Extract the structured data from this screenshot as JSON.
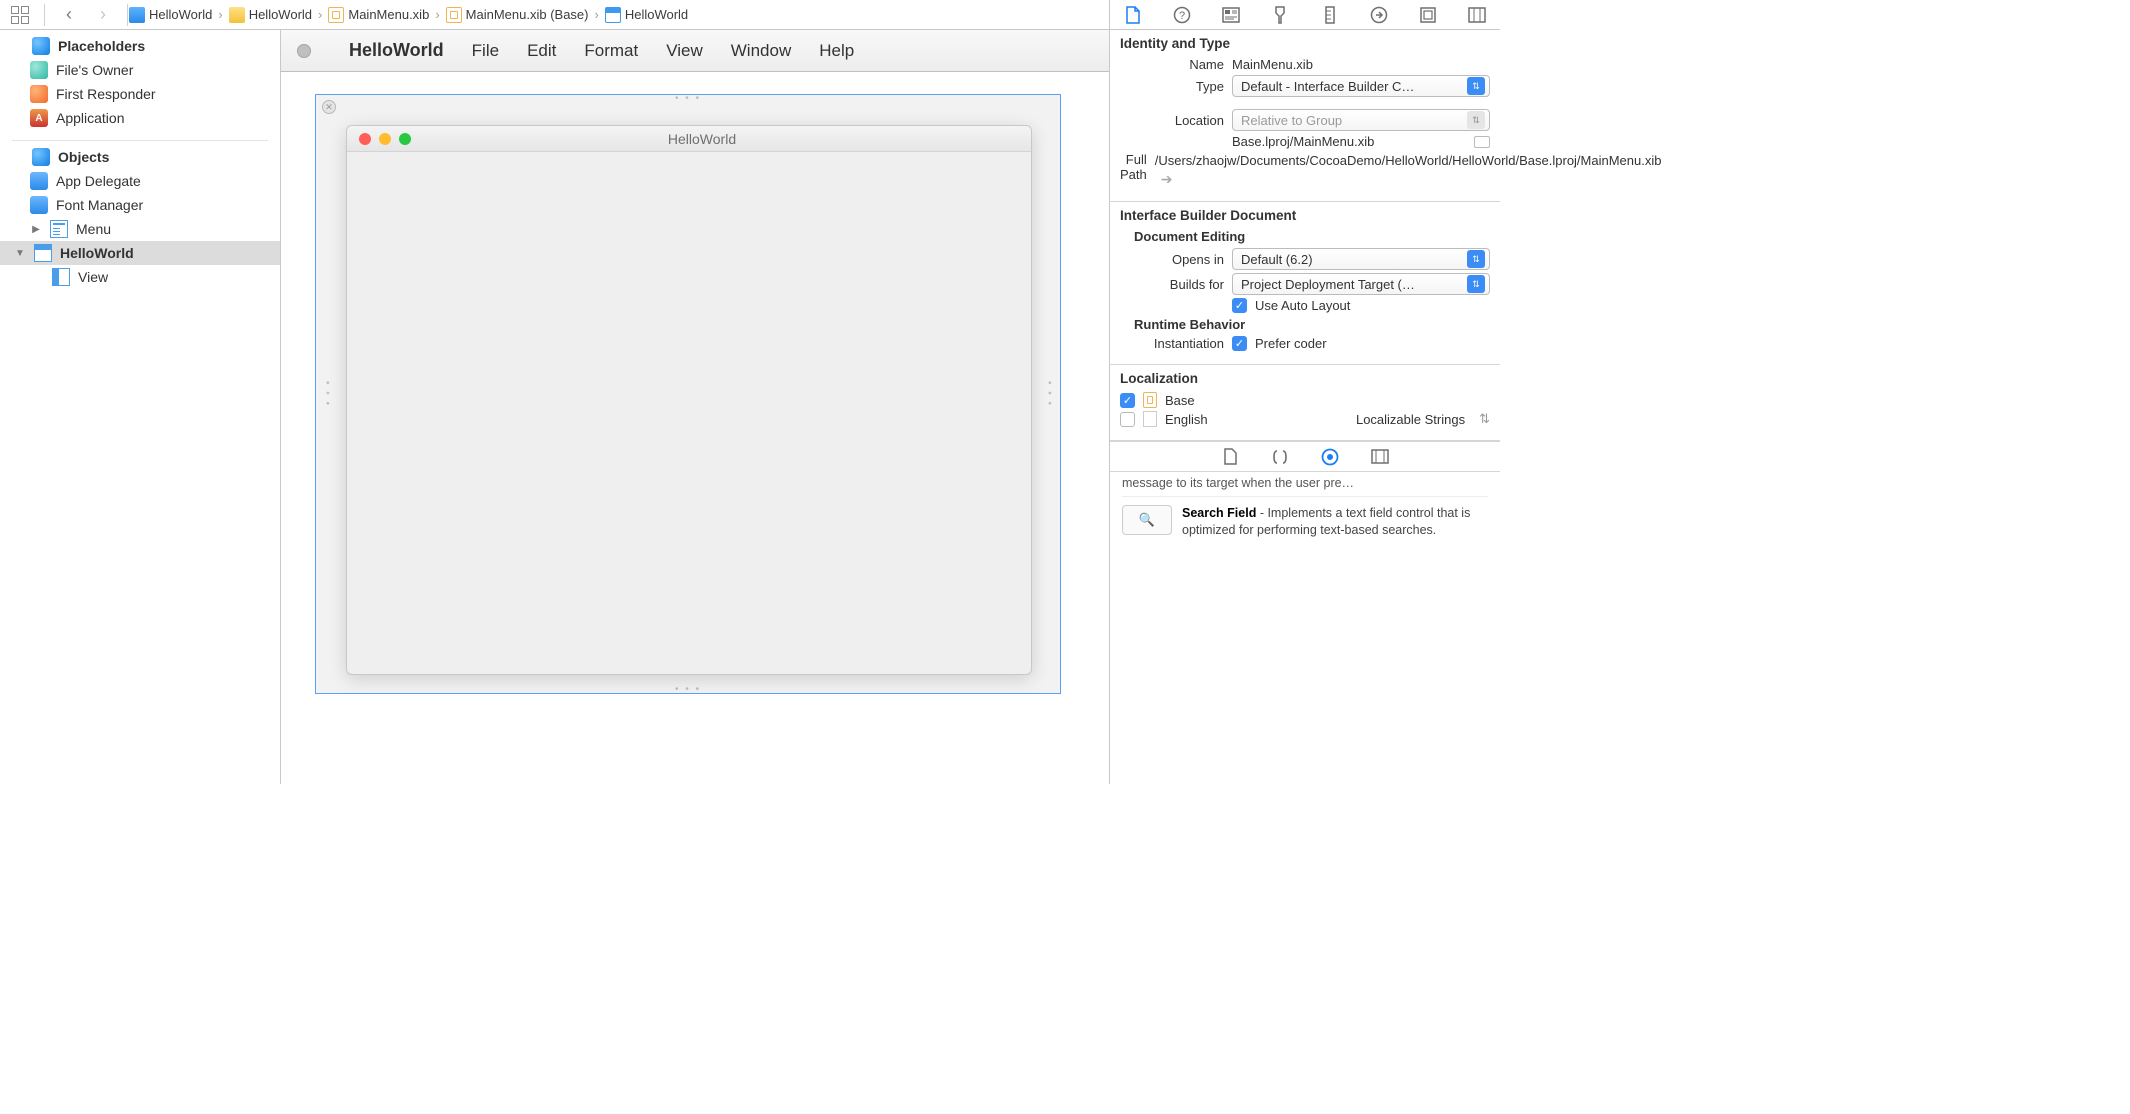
{
  "breadcrumbs": [
    {
      "icon": "proj",
      "label": "HelloWorld"
    },
    {
      "icon": "folder",
      "label": "HelloWorld"
    },
    {
      "icon": "xib",
      "label": "MainMenu.xib"
    },
    {
      "icon": "xib",
      "label": "MainMenu.xib (Base)"
    },
    {
      "icon": "window",
      "label": "HelloWorld"
    }
  ],
  "navigator": {
    "placeholders_title": "Placeholders",
    "placeholders": [
      {
        "icon": "cube-teal",
        "label": "File's Owner"
      },
      {
        "icon": "cube-fire",
        "label": "First Responder"
      },
      {
        "icon": "launcher",
        "label": "Application"
      }
    ],
    "objects_title": "Objects",
    "objects": [
      {
        "icon": "app",
        "label": "App Delegate",
        "disclosure": ""
      },
      {
        "icon": "app",
        "label": "Font Manager",
        "disclosure": ""
      },
      {
        "icon": "menu",
        "label": "Menu",
        "disclosure": "▶"
      }
    ],
    "helloworld": {
      "label": "HelloWorld",
      "disclosure": "▼"
    },
    "view": {
      "label": "View"
    }
  },
  "menubar": {
    "app": "HelloWorld",
    "items": [
      "File",
      "Edit",
      "Format",
      "View",
      "Window",
      "Help"
    ]
  },
  "window_title": "HelloWorld",
  "inspector": {
    "identity_title": "Identity and Type",
    "name_label": "Name",
    "name_value": "MainMenu.xib",
    "type_label": "Type",
    "type_value": "Default - Interface Builder C…",
    "location_label": "Location",
    "location_value": "Relative to Group",
    "location_path": "Base.lproj/MainMenu.xib",
    "fullpath_label": "Full Path",
    "fullpath_value": "/Users/zhaojw/Documents/CocoaDemo/HelloWorld/HelloWorld/Base.lproj/MainMenu.xib",
    "ibd_title": "Interface Builder Document",
    "doc_editing": "Document Editing",
    "opens_label": "Opens in",
    "opens_value": "Default (6.2)",
    "builds_label": "Builds for",
    "builds_value": "Project Deployment Target (…",
    "auto_layout": "Use Auto Layout",
    "runtime_title": "Runtime Behavior",
    "instantiation_label": "Instantiation",
    "prefer_coder": "Prefer coder",
    "loc_title": "Localization",
    "loc_base": "Base",
    "loc_english": "English",
    "loc_english_kind": "Localizable Strings"
  },
  "library": {
    "partial": "message to its target when the user pre…",
    "search_title": "Search Field",
    "search_desc": " - Implements a text field control that is optimized for performing text-based searches."
  }
}
